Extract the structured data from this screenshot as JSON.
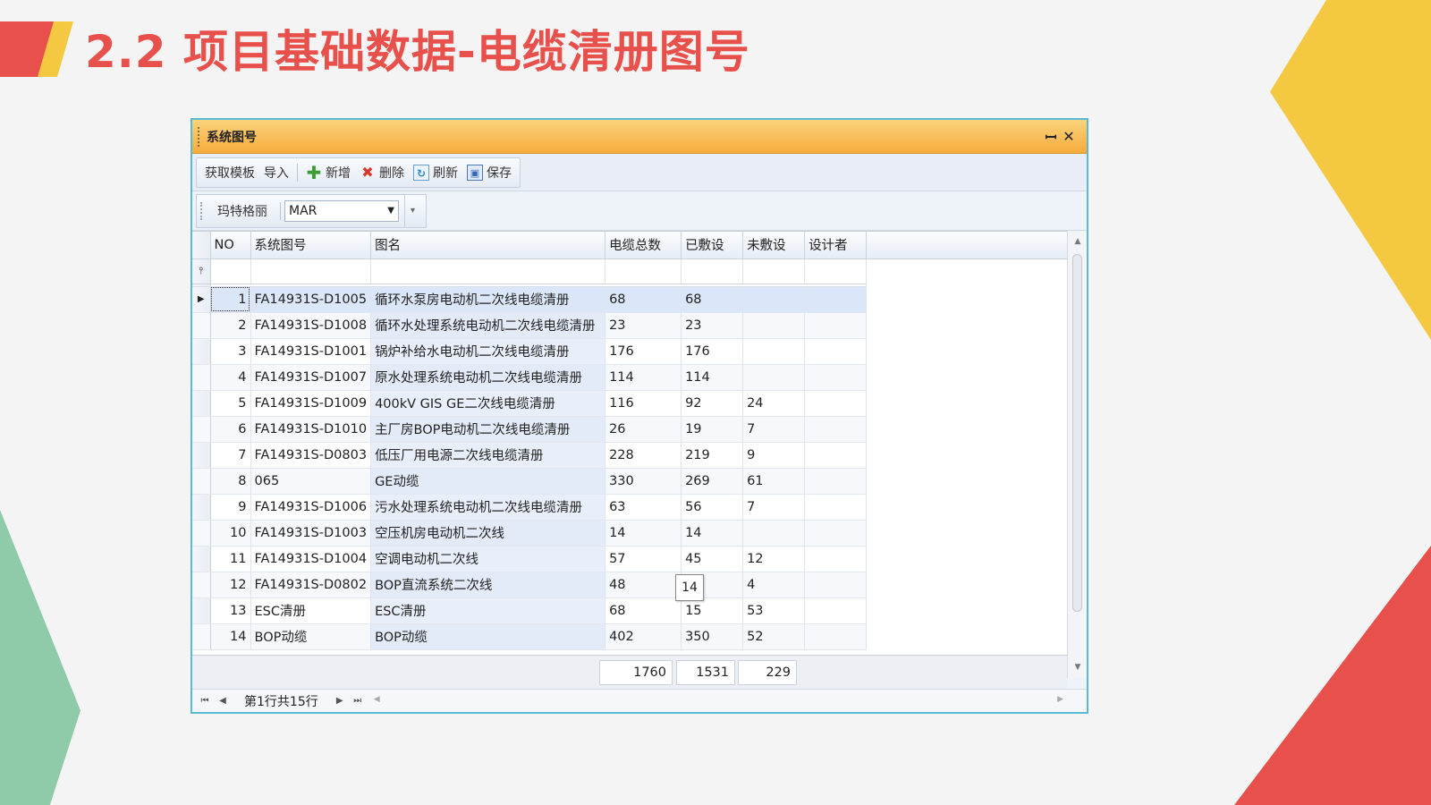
{
  "slide": {
    "title": "2.2 项目基础数据-电缆清册图号"
  },
  "window": {
    "title": "系统图号",
    "pin_icon": "pin-icon",
    "close_icon": "close-icon"
  },
  "toolbar": {
    "get_template": "获取模板",
    "import": "导入",
    "add": "新增",
    "delete": "删除",
    "refresh": "刷新",
    "save": "保存"
  },
  "filterbar": {
    "ship_label": "玛特格丽",
    "combo_value": "MAR"
  },
  "grid": {
    "columns": [
      "NO",
      "系统图号",
      "图名",
      "电缆总数",
      "已敷设",
      "未敷设",
      "设计者"
    ],
    "rows": [
      {
        "no": "1",
        "code": "FA14931S-D1005",
        "name": "循环水泵房电动机二次线电缆清册",
        "total": "68",
        "laid": "68",
        "unlaid": "",
        "designer": ""
      },
      {
        "no": "2",
        "code": "FA14931S-D1008",
        "name": "循环水处理系统电动机二次线电缆清册",
        "total": "23",
        "laid": "23",
        "unlaid": "",
        "designer": ""
      },
      {
        "no": "3",
        "code": "FA14931S-D1001",
        "name": "锅炉补给水电动机二次线电缆清册",
        "total": "176",
        "laid": "176",
        "unlaid": "",
        "designer": ""
      },
      {
        "no": "4",
        "code": "FA14931S-D1007",
        "name": "原水处理系统电动机二次线电缆清册",
        "total": "114",
        "laid": "114",
        "unlaid": "",
        "designer": ""
      },
      {
        "no": "5",
        "code": "FA14931S-D1009",
        "name": "400kV GIS GE二次线电缆清册",
        "total": "116",
        "laid": "92",
        "unlaid": "24",
        "designer": ""
      },
      {
        "no": "6",
        "code": "FA14931S-D1010",
        "name": "主厂房BOP电动机二次线电缆清册",
        "total": "26",
        "laid": "19",
        "unlaid": "7",
        "designer": ""
      },
      {
        "no": "7",
        "code": "FA14931S-D0803",
        "name": "低压厂用电源二次线电缆清册",
        "total": "228",
        "laid": "219",
        "unlaid": "9",
        "designer": ""
      },
      {
        "no": "8",
        "code": "065",
        "name": "GE动缆",
        "total": "330",
        "laid": "269",
        "unlaid": "61",
        "designer": ""
      },
      {
        "no": "9",
        "code": "FA14931S-D1006",
        "name": "污水处理系统电动机二次线电缆清册",
        "total": "63",
        "laid": "56",
        "unlaid": "7",
        "designer": ""
      },
      {
        "no": "10",
        "code": "FA14931S-D1003",
        "name": "空压机房电动机二次线",
        "total": "14",
        "laid": "14",
        "unlaid": "",
        "designer": ""
      },
      {
        "no": "11",
        "code": "FA14931S-D1004",
        "name": "空调电动机二次线",
        "total": "57",
        "laid": "45",
        "unlaid": "12",
        "designer": ""
      },
      {
        "no": "12",
        "code": "FA14931S-D0802",
        "name": "BOP直流系统二次线",
        "total": "48",
        "laid": "",
        "unlaid": "4",
        "designer": ""
      },
      {
        "no": "13",
        "code": "ESC清册",
        "name": "ESC清册",
        "total": "68",
        "laid": "15",
        "unlaid": "53",
        "designer": ""
      },
      {
        "no": "14",
        "code": "BOP动缆",
        "name": "BOP动缆",
        "total": "402",
        "laid": "350",
        "unlaid": "52",
        "designer": ""
      }
    ],
    "totals": {
      "total": "1760",
      "laid": "1531",
      "unlaid": "229"
    },
    "tooltip": "14"
  },
  "pager": {
    "status": "第1行共15行"
  }
}
